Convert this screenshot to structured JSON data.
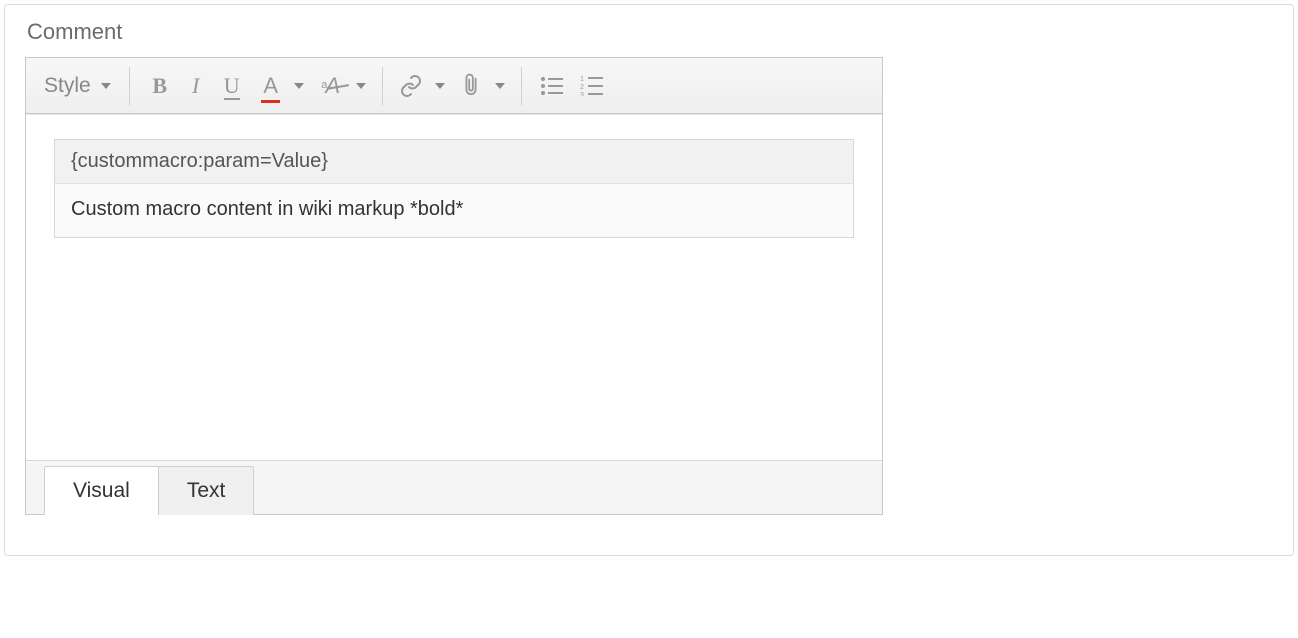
{
  "panel": {
    "title": "Comment"
  },
  "toolbar": {
    "style_label": "Style",
    "bold_glyph": "B",
    "italic_glyph": "I",
    "underline_glyph": "U",
    "color_glyph": "A"
  },
  "content": {
    "macro_header": "{custommacro:param=Value}",
    "macro_body": "Custom macro content in wiki markup *bold*"
  },
  "tabs": {
    "visual": "Visual",
    "text": "Text"
  }
}
